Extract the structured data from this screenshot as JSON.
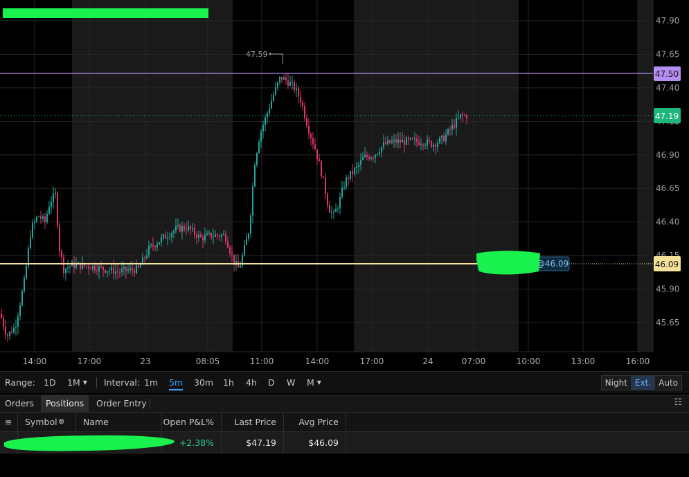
{
  "chart": {
    "price_labels": [
      "47.90",
      "47.65",
      "47.40",
      "47.15",
      "46.90",
      "46.65",
      "46.40",
      "46.15",
      "45.90",
      "45.65"
    ],
    "time_labels": [
      "14:00",
      "17:00",
      "23",
      "08:05",
      "11:00",
      "14:00",
      "17:00",
      "24",
      "07:00",
      "10:00",
      "13:00",
      "16:00"
    ],
    "high_annotation": "47.59",
    "level_line": {
      "label": "47.50",
      "color": "#b48ef0"
    },
    "last_price": {
      "label": "47.19",
      "color": "#1fb67e"
    },
    "avg_price_line": {
      "label": "46.09",
      "tag": "@46.09",
      "color": "#f5e29a"
    }
  },
  "toolbar": {
    "range_label": "Range:",
    "range_options": [
      "1D",
      "1M"
    ],
    "interval_label": "Interval:",
    "interval_options": [
      "1m",
      "5m",
      "30m",
      "1h",
      "4h",
      "D",
      "W",
      "M"
    ],
    "active_interval": "5m",
    "session_options": [
      "Night",
      "Ext.",
      "Auto"
    ],
    "active_session": "Ext."
  },
  "tabs": {
    "items": [
      "Orders",
      "Positions",
      "Order Entry"
    ],
    "active": "Positions"
  },
  "table": {
    "headers": [
      "Symbol",
      "Name",
      "Open P&L%",
      "Last Price",
      "Avg Price"
    ],
    "row": {
      "open_pl": "+2.38%",
      "last_price": "$47.19",
      "avg_price": "$46.09"
    }
  },
  "colors": {
    "up": "#26a69a",
    "down": "#e0356b",
    "background": "#000000",
    "shade": "#1a1a1a"
  }
}
